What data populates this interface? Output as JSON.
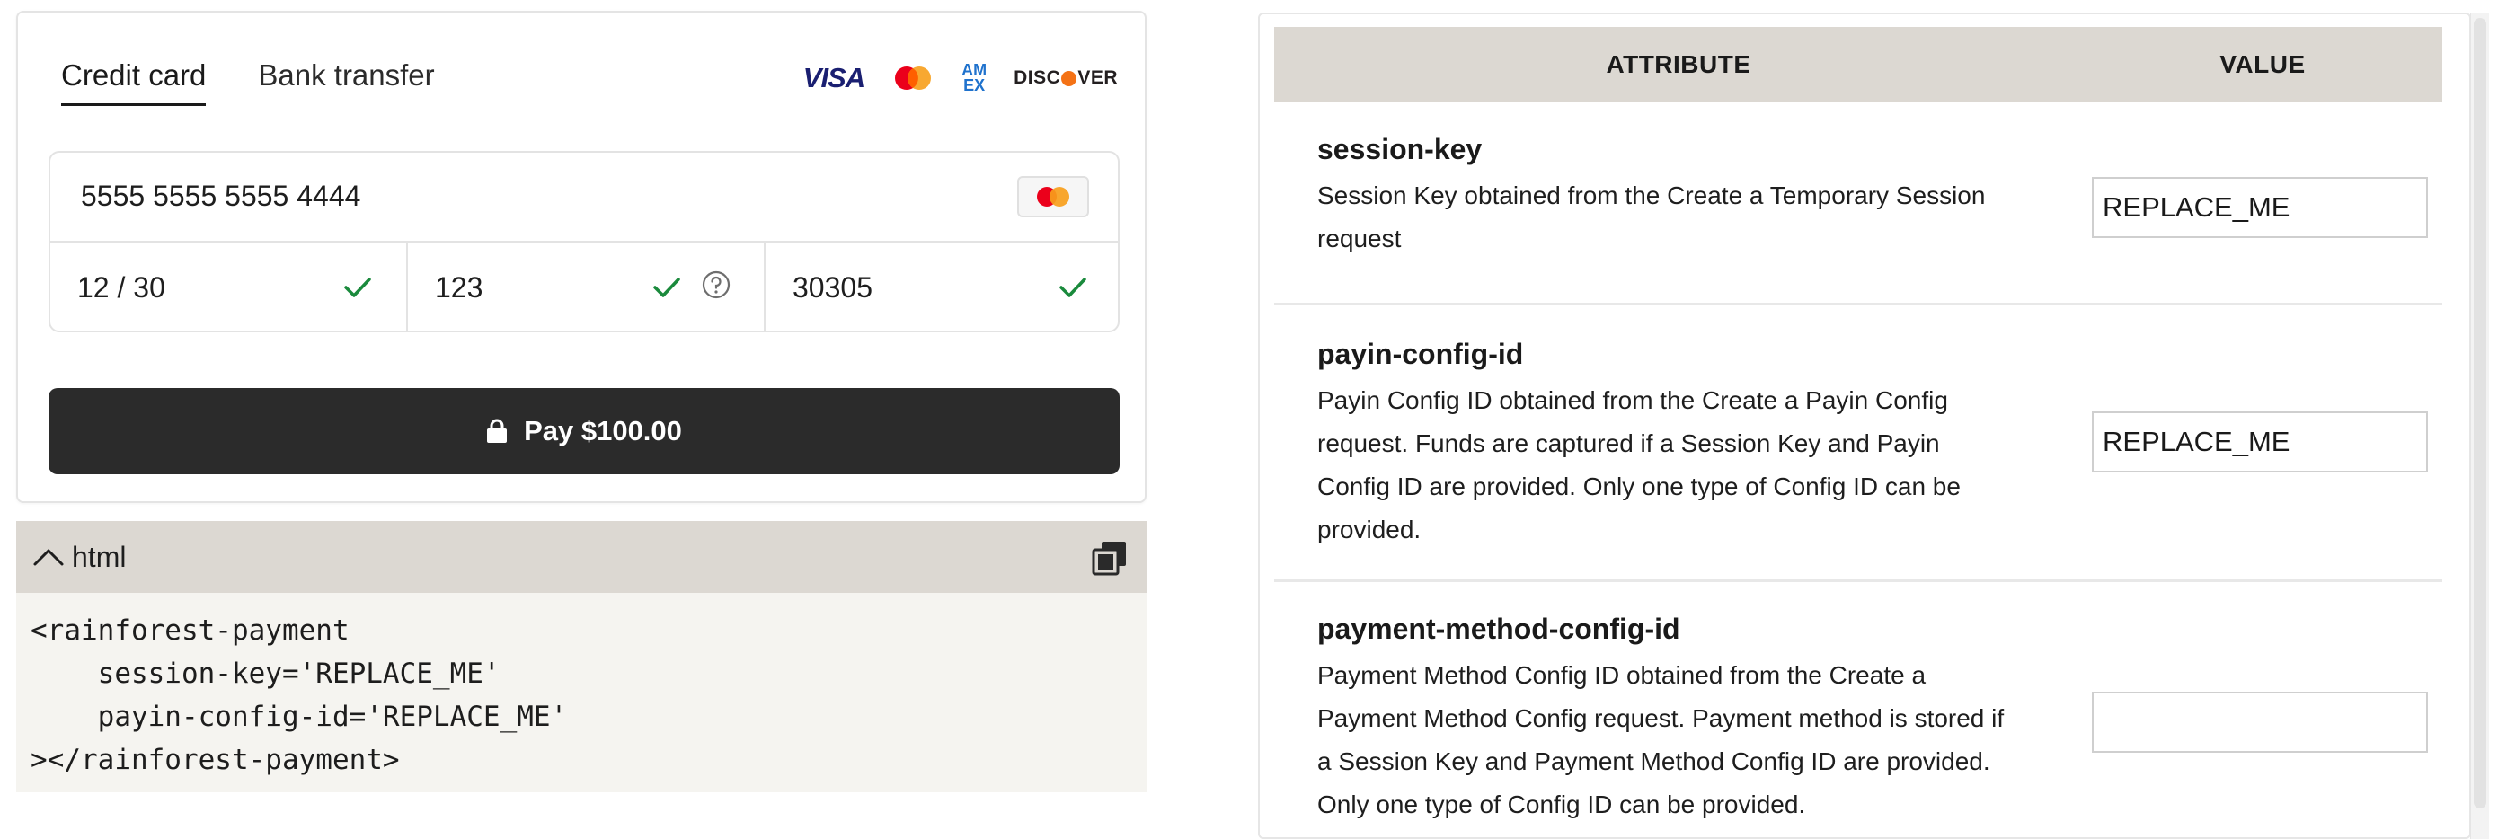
{
  "payment": {
    "tabs": [
      {
        "label": "Credit card",
        "active": true
      },
      {
        "label": "Bank transfer",
        "active": false
      }
    ],
    "brands": {
      "visa": "VISA",
      "amex_line1": "AM",
      "amex_line2": "EX",
      "discover_a": "DISC",
      "discover_b": "VER"
    },
    "card_number": "5555 5555 5555 4444",
    "expiry": "12 / 30",
    "cvc": "123",
    "zip": "30305",
    "pay_label": "Pay $100.00",
    "colors": {
      "button": "#2b2b2b",
      "valid_check": "#1a8a3c",
      "mc_red": "#eb001b",
      "mc_orange": "#f79e1b",
      "visa_blue": "#1a1f71",
      "amex_blue": "#1f72cd",
      "discover_orange": "#f47216"
    }
  },
  "code": {
    "language": "html",
    "lines": [
      "<rainforest-payment",
      "    session-key='REPLACE_ME'",
      "    payin-config-id='REPLACE_ME'",
      "></rainforest-payment>"
    ]
  },
  "table": {
    "headers": {
      "attribute": "ATTRIBUTE",
      "value": "VALUE"
    },
    "rows": [
      {
        "name": "session-key",
        "desc_lines": [
          "Session Key obtained from the Create a Temporary Session",
          "request"
        ],
        "value": "REPLACE_ME"
      },
      {
        "name": "payin-config-id",
        "desc_lines": [
          "Payin Config ID obtained from the Create a Payin Config",
          "request. Funds are captured if a Session Key and Payin",
          "Config ID are provided. Only one type of Config ID can be",
          "provided."
        ],
        "value": "REPLACE_ME"
      },
      {
        "name": "payment-method-config-id",
        "desc_lines": [
          "Payment Method Config ID obtained from the Create a",
          "Payment Method Config request. Payment method is stored if",
          "a Session Key and Payment Method Config ID are provided.",
          "Only one type of Config ID can be provided."
        ],
        "value": ""
      }
    ]
  }
}
